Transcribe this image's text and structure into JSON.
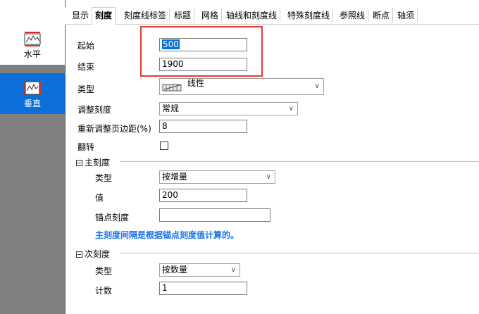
{
  "sidebar": {
    "items": [
      {
        "label": "水平",
        "icon": "horizontal-axis-icon",
        "selected": false
      },
      {
        "label": "垂直",
        "icon": "vertical-axis-icon",
        "selected": true
      }
    ]
  },
  "tabs": [
    "显示",
    "刻度",
    "刻度线标签",
    "标题",
    "网格",
    "轴线和刻度线",
    "特殊刻度线",
    "参照线",
    "断点",
    "轴须"
  ],
  "active_tab": "刻度",
  "form": {
    "start_label": "起始",
    "start_value": "500",
    "end_label": "结束",
    "end_value": "1900",
    "type_label": "类型",
    "type_value": "线性",
    "type_icon": "linear-scale-icon",
    "adjust_label": "调整刻度",
    "adjust_value": "常规",
    "rescale_label": "重新调整页边距(%)",
    "rescale_value": "8",
    "flip_label": "翻转",
    "flip_checked": false
  },
  "major": {
    "title": "主刻度",
    "type_label": "类型",
    "type_value": "按增量",
    "value_label": "值",
    "value_value": "200",
    "anchor_label": "锚点刻度",
    "anchor_value": "",
    "note": "主刻度间隔是根据锚点刻度值计算的。"
  },
  "minor": {
    "title": "次刻度",
    "type_label": "类型",
    "type_value": "按数量",
    "count_label": "计数",
    "count_value": "1"
  },
  "colors": {
    "selection": "#0a6fd8",
    "highlight_box": "#e53935",
    "note_text": "#1a73e8"
  }
}
